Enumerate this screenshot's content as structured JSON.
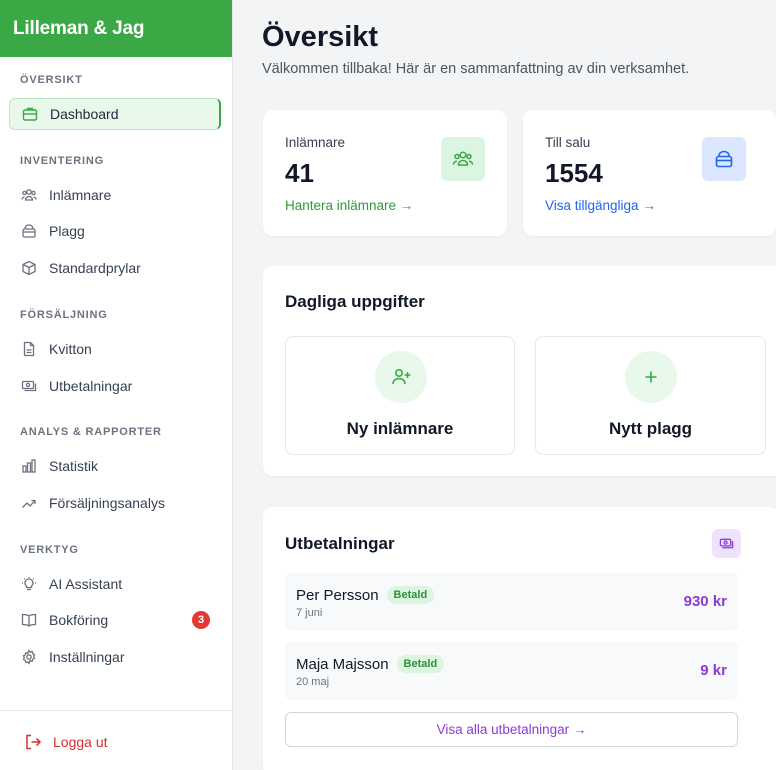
{
  "sidebar": {
    "brand": "Lilleman & Jag",
    "sections": {
      "overview": "ÖVERSIKT",
      "inventory": "INVENTERING",
      "sales": "FÖRSÄLJNING",
      "analytics": "ANALYS & RAPPORTER",
      "tools": "VERKTYG"
    },
    "items": {
      "dashboard": "Dashboard",
      "consignors": "Inlämnare",
      "garments": "Plagg",
      "standard": "Standardprylar",
      "receipts": "Kvitton",
      "payouts": "Utbetalningar",
      "statistics": "Statistik",
      "sales_analysis": "Försäljningsanalys",
      "ai": "AI Assistant",
      "bookkeeping": "Bokföring",
      "settings": "Inställningar"
    },
    "bookkeeping_badge": "3",
    "logout": "Logga ut"
  },
  "main": {
    "title": "Översikt",
    "subtitle": "Välkommen tillbaka! Här är en sammanfattning av din verksamhet.",
    "stats": [
      {
        "label": "Inlämnare",
        "value": "41",
        "link": "Hantera inlämnare →"
      },
      {
        "label": "Till salu",
        "value": "1554",
        "link": "Visa tillgängliga →"
      }
    ],
    "daily": {
      "title": "Dagliga uppgifter",
      "tasks": [
        "Ny inlämnare",
        "Nytt plagg"
      ]
    },
    "payouts": {
      "title": "Utbetalningar",
      "rows": [
        {
          "name": "Per Persson",
          "status": "Betald",
          "date": "7 juni",
          "amount": "930 kr"
        },
        {
          "name": "Maja Majsson",
          "status": "Betald",
          "date": "20 maj",
          "amount": "9 kr"
        }
      ],
      "view_all": "Visa alla utbetalningar →"
    }
  },
  "colors": {
    "brand_green": "#3aa845",
    "link_green": "#2e9a3c",
    "link_blue": "#2563eb",
    "accent_purple": "#8e3bd6",
    "danger_red": "#e53935"
  }
}
